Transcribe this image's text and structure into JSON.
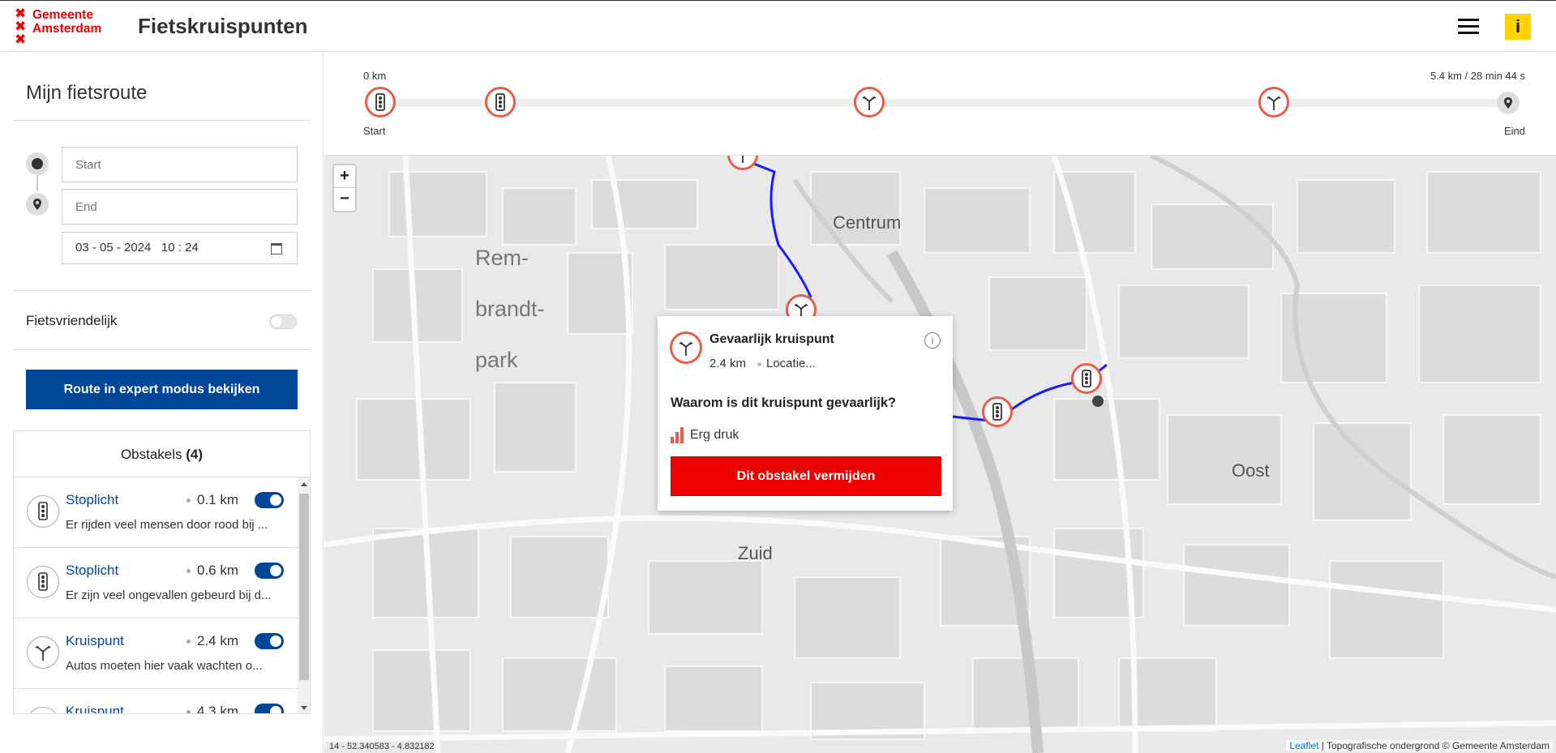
{
  "header": {
    "logo_text": "Gemeente Amsterdam",
    "logo_line1": "Gemeente",
    "logo_line2": "Amsterdam",
    "title": "Fietskruispunten",
    "info_label": "i",
    "accent_color": "#ec0000",
    "info_color": "#ffd200"
  },
  "sidebar": {
    "title": "Mijn fietsroute",
    "start_placeholder": "Start",
    "end_placeholder": "End",
    "date_value": "03 - 05 - 2024   10 : 24",
    "bike_friendly_label": "Fietsvriendelijk",
    "bike_friendly_on": false,
    "expert_button": "Route in expert modus bekijken",
    "obstacles_label": "Obstakels",
    "obstacles_count": "(4)",
    "obstacles": [
      {
        "name": "Stoplicht",
        "distance": "0.1 km",
        "enabled": true,
        "icon": "traffic-light-icon",
        "description": "Er rijden veel mensen door rood bij ..."
      },
      {
        "name": "Stoplicht",
        "distance": "0.6 km",
        "enabled": true,
        "icon": "traffic-light-icon",
        "description": "Er zijn veel ongevallen gebeurd bij d..."
      },
      {
        "name": "Kruispunt",
        "distance": "2.4 km",
        "enabled": true,
        "icon": "intersection-icon",
        "description": "Autos moeten hier vaak wachten o..."
      },
      {
        "name": "Kruispunt",
        "distance": "4.3 km",
        "enabled": true,
        "icon": "intersection-icon",
        "description": ""
      }
    ]
  },
  "timeline": {
    "start_km": "0 km",
    "summary": "5.4 km / 28 min 44 s",
    "start_label": "Start",
    "end_label": "Eind",
    "markers": [
      "traffic-light-icon",
      "traffic-light-icon",
      "intersection-icon",
      "intersection-icon",
      "location-pin-icon"
    ]
  },
  "map": {
    "zoom_in": "+",
    "zoom_out": "−",
    "labels": {
      "centrum": "Centrum",
      "rembrandt1": "Rem-",
      "rembrandt2": "brandt-",
      "rembrandt3": "park",
      "oost": "Oost",
      "zuid": "Zuid"
    },
    "coords": "14 - 52.340583 - 4.832182",
    "attribution_link": "Leaflet",
    "attribution_text": " | Topografische ondergrond © Gemeente Amsterdam",
    "route_color": "#1a1aff"
  },
  "popup": {
    "title": "Gevaarlijk kruispunt",
    "distance": "2.4 km",
    "location": "Locatie...",
    "question": "Waarom is dit kruispunt gevaarlijk?",
    "reason": "Erg druk",
    "button": "Dit obstakel vermijden",
    "marker_color": "#ec5b45"
  }
}
